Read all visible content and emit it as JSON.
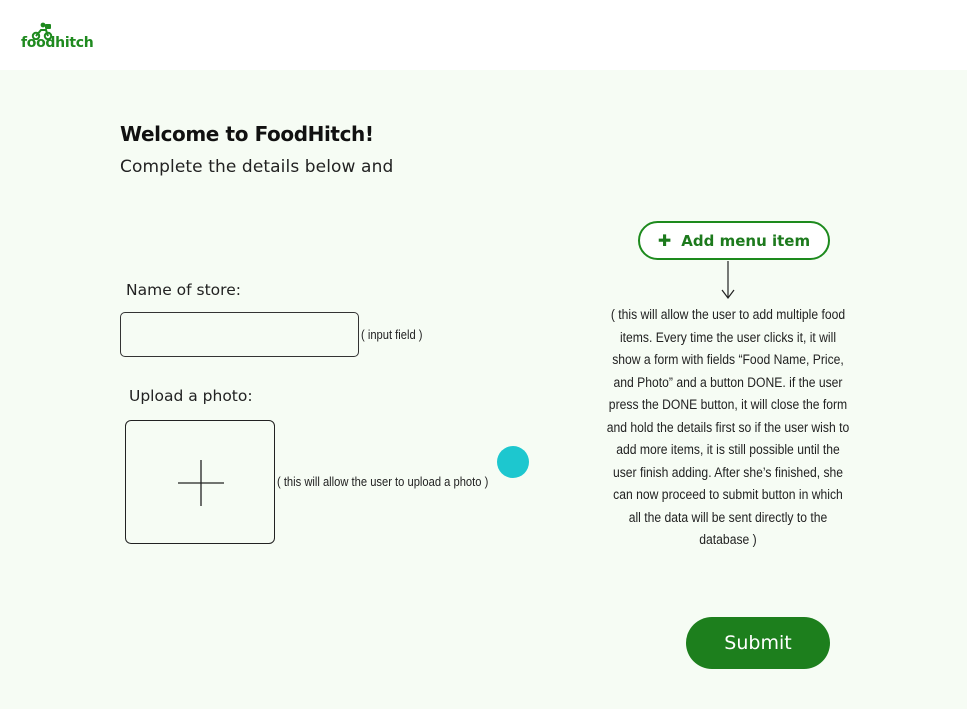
{
  "header": {
    "logo_text": "foodhitch"
  },
  "main": {
    "title": "Welcome to FoodHitch!",
    "subtitle": "Complete the details below and",
    "store_label": "Name of store:",
    "store_value": "",
    "store_note": "( input field )",
    "photo_label": "Upload a photo:",
    "photo_note": "( this will allow the user to upload a photo )"
  },
  "menu": {
    "add_label": "Add menu item",
    "add_icon": "plus-icon",
    "note": "( this will allow the user to add multiple food items. Every time the user clicks it,  it will show a form with fields “Food Name, Price, and Photo” and a button DONE. if the user press the DONE button, it will close the form and hold the details first so if the user wish to add more items, it is still possible until the user finish adding. After she’s finished, she can now proceed to submit button in which all the data will be sent directly to the database  )"
  },
  "actions": {
    "submit_label": "Submit"
  },
  "colors": {
    "brand": "#1d7f1d",
    "background": "#f6fcf4",
    "cursor": "#1dc7cf"
  }
}
